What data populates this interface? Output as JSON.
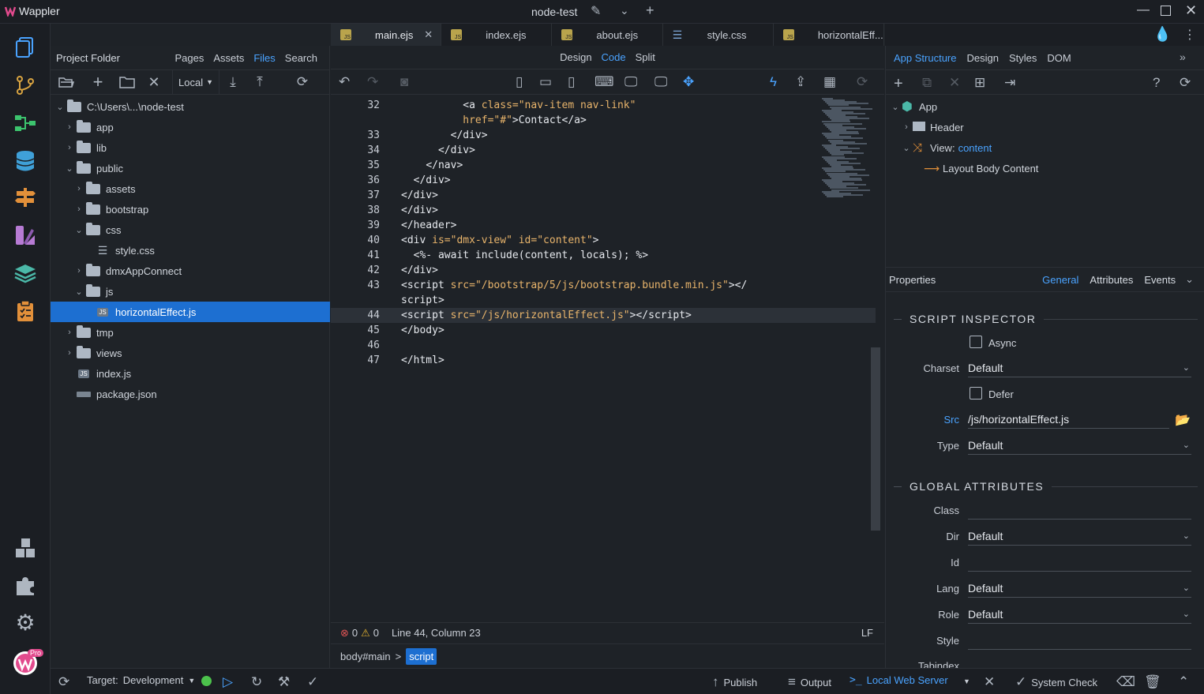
{
  "app": {
    "name": "Wappler",
    "project_title": "node-test"
  },
  "project_panel": {
    "title": "Project Folder",
    "tabs": [
      "Pages",
      "Assets",
      "Files",
      "Search"
    ],
    "active_tab": "Files",
    "target_select": "Local",
    "tree": [
      {
        "label": "C:\\Users\\...\\node-test",
        "depth": 0,
        "open": true,
        "type": "folder"
      },
      {
        "label": "app",
        "depth": 1,
        "open": false,
        "type": "folder"
      },
      {
        "label": "lib",
        "depth": 1,
        "open": false,
        "type": "folder"
      },
      {
        "label": "public",
        "depth": 1,
        "open": true,
        "type": "folder"
      },
      {
        "label": "assets",
        "depth": 2,
        "open": false,
        "type": "folder"
      },
      {
        "label": "bootstrap",
        "depth": 2,
        "open": false,
        "type": "folder"
      },
      {
        "label": "css",
        "depth": 2,
        "open": true,
        "type": "folder"
      },
      {
        "label": "style.css",
        "depth": 3,
        "type": "css"
      },
      {
        "label": "dmxAppConnect",
        "depth": 2,
        "open": false,
        "type": "folder"
      },
      {
        "label": "js",
        "depth": 2,
        "open": true,
        "type": "folder"
      },
      {
        "label": "horizontalEffect.js",
        "depth": 3,
        "type": "js",
        "selected": true
      },
      {
        "label": "tmp",
        "depth": 1,
        "open": false,
        "type": "folder"
      },
      {
        "label": "views",
        "depth": 1,
        "open": false,
        "type": "folder"
      },
      {
        "label": "index.js",
        "depth": 1,
        "type": "js"
      },
      {
        "label": "package.json",
        "depth": 1,
        "type": "json"
      }
    ]
  },
  "editor": {
    "tabs": [
      {
        "label": "main.ejs",
        "type": "js",
        "active": true
      },
      {
        "label": "index.ejs",
        "type": "js"
      },
      {
        "label": "about.ejs",
        "type": "js"
      },
      {
        "label": "style.css",
        "type": "css"
      },
      {
        "label": "horizontalEff...",
        "type": "js"
      }
    ],
    "modes": [
      "Design",
      "Code",
      "Split"
    ],
    "active_mode": "Code",
    "lines": [
      {
        "n": "32",
        "html": "          <span class='t'>&lt;a</span> <span class='a'>class=</span><span class='s'>\"nav-item nav-link\"</span>"
      },
      {
        "n": "",
        "html": "          <span class='a'>href=</span><span class='s'>\"#\"</span><span class='t'>&gt;Contact&lt;/a&gt;</span>"
      },
      {
        "n": "33",
        "html": "        <span class='t'>&lt;/div&gt;</span>"
      },
      {
        "n": "34",
        "html": "      <span class='t'>&lt;/div&gt;</span>"
      },
      {
        "n": "35",
        "html": "    <span class='t'>&lt;/nav&gt;</span>"
      },
      {
        "n": "36",
        "html": "  <span class='t'>&lt;/div&gt;</span>"
      },
      {
        "n": "37",
        "html": "<span class='t'>&lt;/div&gt;</span>"
      },
      {
        "n": "38",
        "html": "<span class='t'>&lt;/div&gt;</span>"
      },
      {
        "n": "39",
        "html": "<span class='t'>&lt;/header&gt;</span>"
      },
      {
        "n": "40",
        "html": "<span class='t'>&lt;div</span> <span class='a'>is=</span><span class='s'>\"dmx-view\"</span> <span class='a'>id=</span><span class='s'>\"content\"</span><span class='t'>&gt;</span>"
      },
      {
        "n": "41",
        "html": "  <span class='k'>&lt;%- await include(content, locals); %&gt;</span>"
      },
      {
        "n": "42",
        "html": "<span class='t'>&lt;/div&gt;</span>"
      },
      {
        "n": "43",
        "html": "<span class='t'>&lt;script</span> <span class='a'>src=</span><span class='s'>\"/bootstrap/5/js/bootstrap.bundle.min.js\"</span><span class='t'>&gt;&lt;/</span>"
      },
      {
        "n": "",
        "html": "<span class='t'>script&gt;</span>"
      },
      {
        "n": "44",
        "html": "<span class='t'>&lt;script</span> <span class='a'>src=</span><span class='s'>\"/js/horizontalEffect.js\"</span><span class='t'>&gt;&lt;/script&gt;</span>",
        "highlight": true
      },
      {
        "n": "45",
        "html": "<span class='t'>&lt;/body&gt;</span>"
      },
      {
        "n": "46",
        "html": ""
      },
      {
        "n": "47",
        "html": "<span class='t'>&lt;/html&gt;</span>"
      }
    ],
    "status": {
      "errors": "0",
      "warnings": "0",
      "position": "Line 44, Column 23",
      "eol": "LF"
    },
    "breadcrumb": {
      "parent": "body#main",
      "separator": ">",
      "current": "script"
    }
  },
  "structure_panel": {
    "tabs": [
      "App Structure",
      "Design",
      "Styles",
      "DOM"
    ],
    "active_tab": "App Structure",
    "tree": [
      {
        "label": "App"
      },
      {
        "label": "Header"
      },
      {
        "label": "View:",
        "sub": "content"
      },
      {
        "label": "Layout Body Content"
      }
    ]
  },
  "properties": {
    "title": "Properties",
    "tabs": [
      "General",
      "Attributes",
      "Events"
    ],
    "active_tab": "General",
    "script_section": "SCRIPT INSPECTOR",
    "global_section": "GLOBAL ATTRIBUTES",
    "async_label": "Async",
    "defer_label": "Defer",
    "charset_label": "Charset",
    "charset_value": "Default",
    "src_label": "Src",
    "src_value": "/js/horizontalEffect.js",
    "type_label": "Type",
    "type_value": "Default",
    "class_label": "Class",
    "dir_label": "Dir",
    "dir_value": "Default",
    "id_label": "Id",
    "lang_label": "Lang",
    "lang_value": "Default",
    "role_label": "Role",
    "role_value": "Default",
    "style_label": "Style",
    "tabindex_label": "Tabindex"
  },
  "bottombar": {
    "target_label": "Target:",
    "target_value": "Development",
    "publish": "Publish",
    "output": "Output",
    "server": "Local Web Server",
    "system_check": "System Check",
    "pro_badge": "Pro"
  }
}
